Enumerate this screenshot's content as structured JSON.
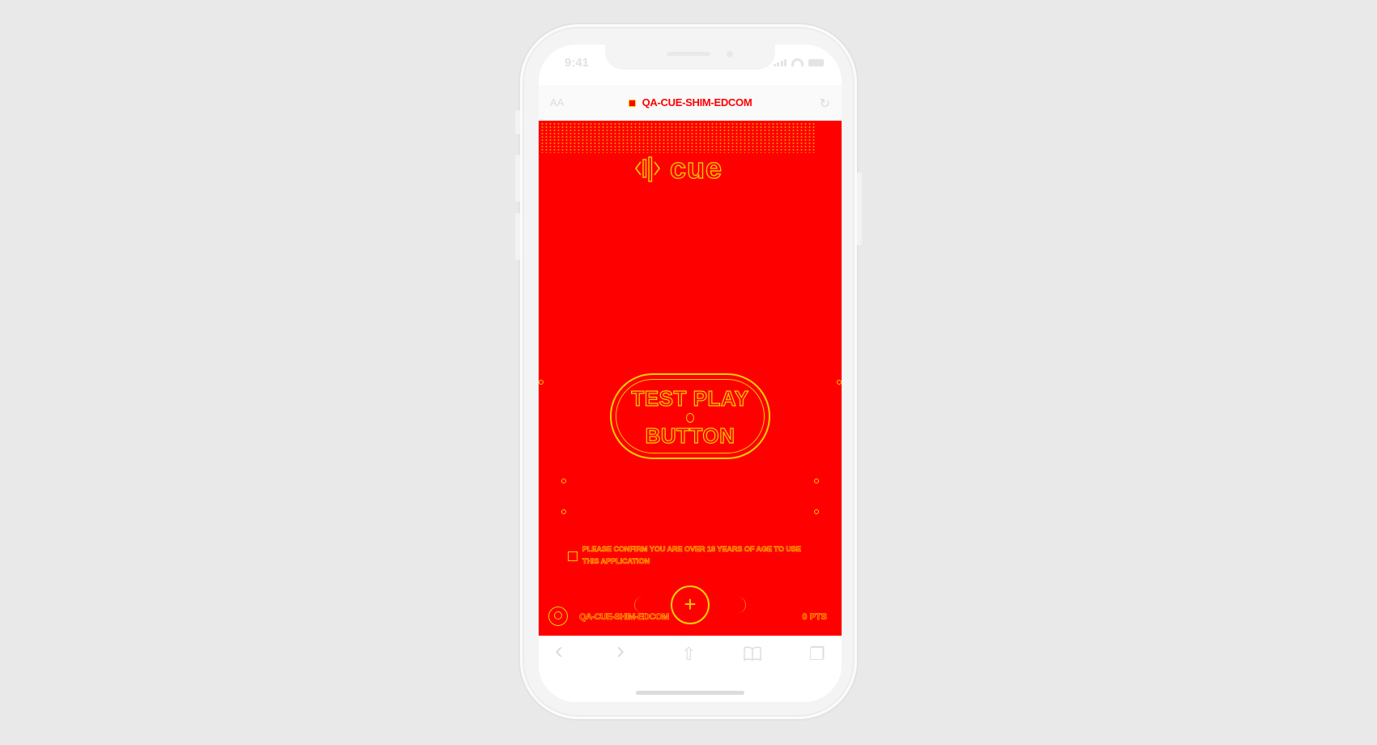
{
  "status_bar": {
    "time": "9:41"
  },
  "browser": {
    "text_size_label": "AA",
    "url": "QA-CUE-SHIM-EDCOM",
    "reload_icon": "reload-icon"
  },
  "app": {
    "logo_text": "cue",
    "play_button": {
      "line1": "TEST PLAY",
      "line2": "BUTTON"
    },
    "consent_text": "PLEASE CONFIRM YOU ARE OVER 18 YEARS OF AGE TO USE THIS APPLICATION",
    "add_icon": "+",
    "bottom_code": "QA-CUE-SHIM-EDCOM",
    "bottom_count": "0 PTS"
  },
  "toolbar": {
    "back_icon": "‹",
    "forward_icon": "›",
    "share_icon": "⇧",
    "bookmarks_icon": "📖",
    "tabs_icon": "❐"
  },
  "colors": {
    "content_bg": "#ff0000",
    "outline": "#ffd000",
    "frame": "#f4f4f4",
    "backdrop": "#e9e9e9"
  }
}
